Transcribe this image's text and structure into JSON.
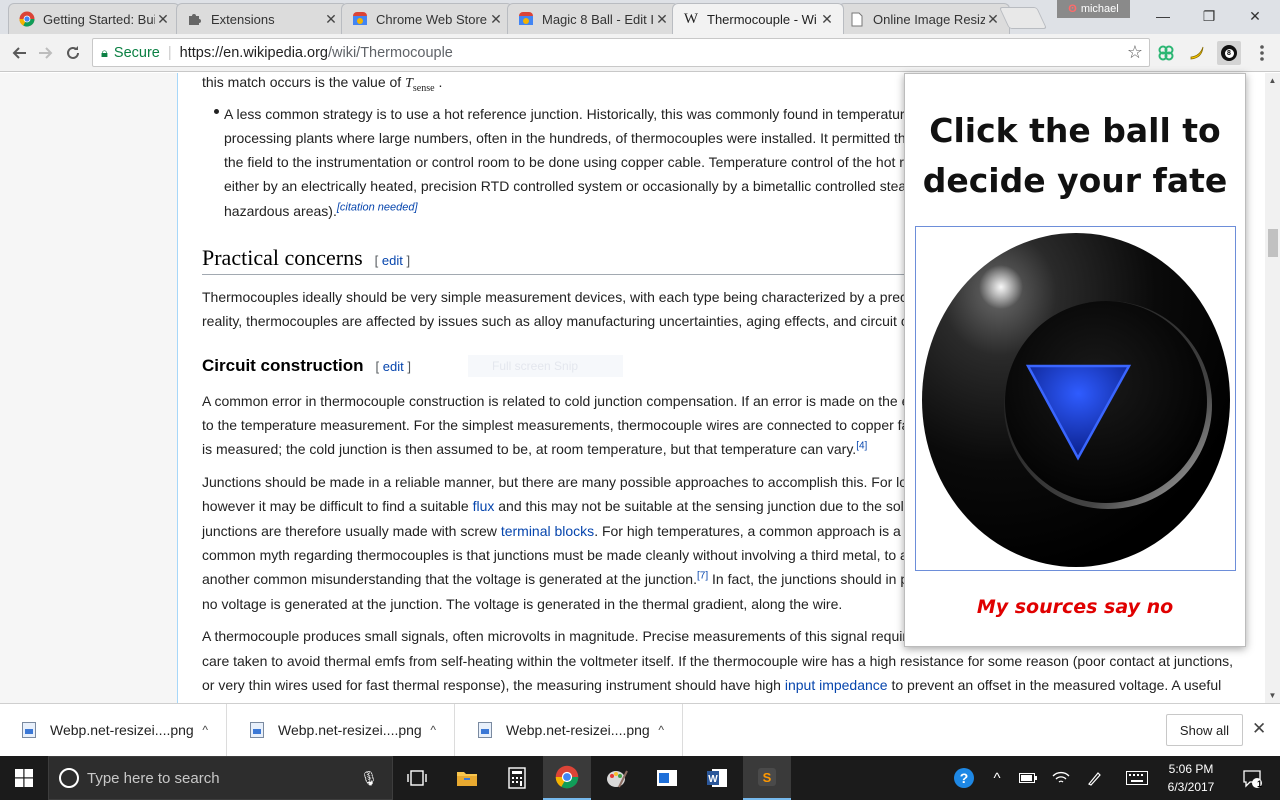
{
  "browser": {
    "tabs": [
      {
        "title": "Getting Started: Bui",
        "icon": "chrome-icon",
        "active": false
      },
      {
        "title": "Extensions",
        "icon": "puzzle-icon",
        "active": false
      },
      {
        "title": "Chrome Web Store",
        "icon": "webstore-icon",
        "active": false
      },
      {
        "title": "Magic 8 Ball - Edit I",
        "icon": "webstore-icon",
        "active": false
      },
      {
        "title": "Thermocouple - Wi",
        "icon": "wikipedia-icon",
        "active": true
      },
      {
        "title": "Online Image Resiz",
        "icon": "page-icon",
        "active": false
      }
    ],
    "tab_close_glyph": "✕",
    "profile_name": "michael",
    "window_controls": {
      "minimize": "—",
      "restore": "❐",
      "close": "✕"
    },
    "omnibox": {
      "secure_label": "Secure",
      "url_host": "https://en.wikipedia.org",
      "url_path": "/wiki/Thermocouple"
    }
  },
  "article": {
    "line0_a": "this match occurs is the value of ",
    "line0_var": "T",
    "line0_sub": "sense",
    "line0_end": " .",
    "bullet_lines": [
      "A less common strategy is to use a hot reference junction. Historically, this was commonly found in temperatur",
      "processing plants where large numbers, often in the hundreds, of thermocouples were installed. It permitted th",
      "the field to the instrumentation or control room to be done using copper cable. Temperature control of the hot r",
      "either by an electrically heated, precision RTD controlled system or occasionally by a bimetallic controlled stea"
    ],
    "bullet_last": "hazardous areas).",
    "citation_needed": "[citation needed]",
    "h2": "Practical concerns",
    "edit_open": "[ ",
    "edit_label": "edit",
    "edit_close": " ]",
    "p1_lines": [
      "Thermocouples ideally should be very simple measurement devices, with each type being characterized by a prec",
      "reality, thermocouples are affected by issues such as alloy manufacturing uncertainties, aging effects, and circuit c"
    ],
    "h3": "Circuit construction",
    "faint_overlay": "Full screen Snip",
    "p2_lines": [
      "A common error in thermocouple construction is related to cold junction compensation. If an error is made on the e",
      "to the temperature measurement. For the simplest measurements, thermocouple wires are connected to copper fa"
    ],
    "p2_last": "is measured; the cold junction is then assumed to be, at room temperature, but that temperature can vary.",
    "ref4": "[4]",
    "p3_line1": "Junctions should be made in a reliable manner, but there are many possible approaches to accomplish this. For lo",
    "p3_line2_a": "however it may be difficult to find a suitable ",
    "p3_flux": "flux",
    "p3_line2_b": " and this may not be suitable at the sensing junction due to the sol",
    "p3_line3_a": "junctions are therefore usually made with screw ",
    "p3_terminal": "terminal blocks",
    "p3_line3_b": ". For high temperatures, a common approach is a",
    "p3_line4": "common myth regarding thermocouples is that junctions must be made cleanly without involving a third metal, to a",
    "p3_line5_a": "another common misunderstanding that the voltage is generated at the junction.",
    "ref7": "[7]",
    "p3_line5_b": " In fact, the junctions should in p",
    "p3_line6": "no voltage is generated at the junction. The voltage is generated in the thermal gradient, along the wire.",
    "p4_line1": "A thermocouple produces small signals, often microvolts in magnitude. Precise measurements of this signal requir",
    "p4_line2": "care taken to avoid thermal emfs from self-heating within the voltmeter itself. If the thermocouple wire has a high resistance for some reason (poor contact at junctions,",
    "p4_line3_a": "or very thin wires used for fast thermal response), the measuring instrument should have high ",
    "p4_impedance": "input impedance",
    "p4_line3_b": " to prevent an offset in the measured voltage. A useful"
  },
  "popup": {
    "title_line1": "Click the ball to",
    "title_line2": "decide your fate",
    "answer": "My sources say no"
  },
  "downloads": {
    "items": [
      "Webp.net-resizei....png",
      "Webp.net-resizei....png",
      "Webp.net-resizei....png"
    ],
    "show_all": "Show all"
  },
  "taskbar": {
    "search_placeholder": "Type here to search",
    "time": "5:06 PM",
    "date": "6/3/2017",
    "notification_count": "1"
  },
  "colors": {
    "link": "#0645ad",
    "secure_green": "#0b8043",
    "answer_red": "#e00000",
    "triangle_blue": "#1c3fcf",
    "taskbar": "#1b1b1b"
  }
}
